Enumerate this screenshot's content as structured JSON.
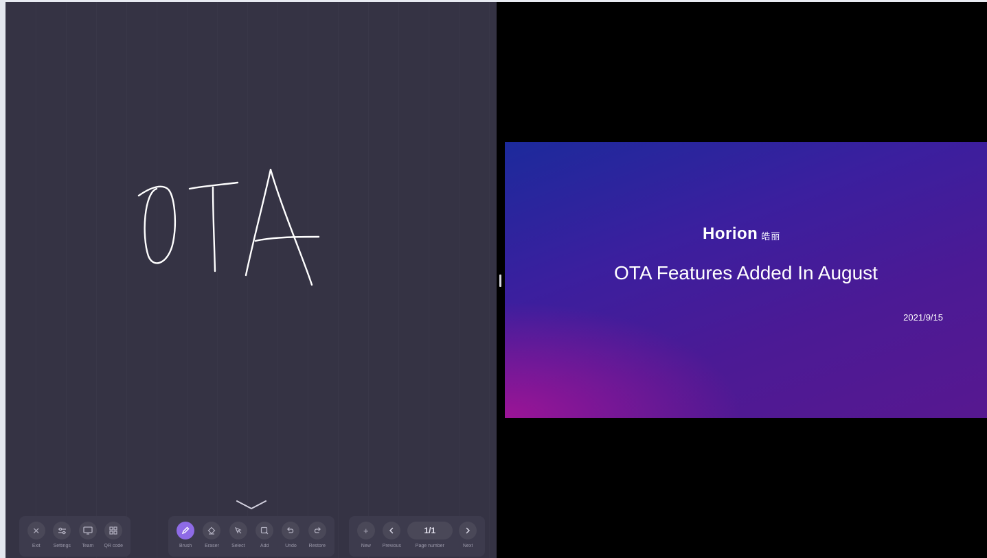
{
  "whiteboard": {
    "handwriting_text": "OTA",
    "background_color": "#353344",
    "stroke_color": "#ffffff"
  },
  "toolbar": {
    "group_left": [
      {
        "id": "exit",
        "label": "Exit",
        "icon": "close-icon"
      },
      {
        "id": "settings",
        "label": "Settings",
        "icon": "sliders-icon"
      },
      {
        "id": "team",
        "label": "Team",
        "icon": "monitor-icon"
      },
      {
        "id": "qrcode",
        "label": "QR code",
        "icon": "qr-code-icon"
      }
    ],
    "group_center": [
      {
        "id": "brush",
        "label": "Brush",
        "icon": "pen-icon",
        "active": true
      },
      {
        "id": "eraser",
        "label": "Eraser",
        "icon": "eraser-icon"
      },
      {
        "id": "select",
        "label": "Select",
        "icon": "select-icon"
      },
      {
        "id": "add",
        "label": "Add",
        "icon": "add-shape-icon"
      },
      {
        "id": "undo",
        "label": "Undo",
        "icon": "undo-icon"
      },
      {
        "id": "restore",
        "label": "Restore",
        "icon": "redo-icon"
      }
    ],
    "group_right": {
      "new_label": "New",
      "previous_label": "Previous",
      "page_number_label": "Page number",
      "page_value": "1/1",
      "next_label": "Next"
    },
    "accent_color": "#8e6be6"
  },
  "slide": {
    "logo_text": "Horion",
    "logo_cn": "皓丽",
    "title": "OTA Features Added In August",
    "date": "2021/9/15"
  }
}
